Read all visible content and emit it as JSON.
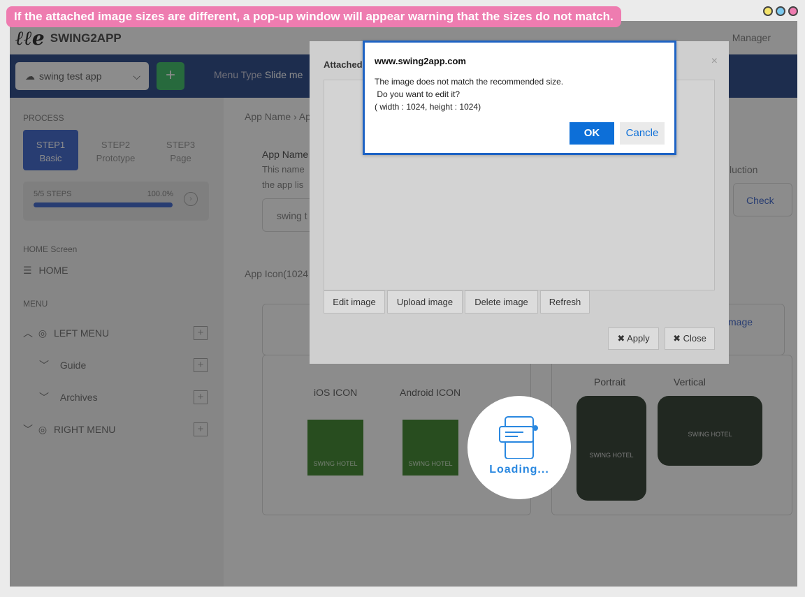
{
  "caption": "If the attached image sizes are different, a pop-up window will appear warning that the sizes do not match.",
  "window_dots": {
    "colors": [
      "#f5e46a",
      "#7ac8ee",
      "#ee7cb0"
    ]
  },
  "topbar": {
    "brand": "SWING2APP",
    "manager": "Manager"
  },
  "toolbar": {
    "app_select": "swing test app",
    "add_label": "+",
    "menu_type_label": "Menu Type",
    "menu_type_value": "Slide me"
  },
  "sidebar": {
    "process_label": "PROCESS",
    "steps": [
      {
        "num": "STEP1",
        "name": "Basic"
      },
      {
        "num": "STEP2",
        "name": "Prototype"
      },
      {
        "num": "STEP3",
        "name": "Page"
      }
    ],
    "progress_steps": "5/5 STEPS",
    "progress_pct": "100.0%",
    "progress_value": 1.0,
    "home_screen_label": "HOME Screen",
    "home_item": "HOME",
    "menu_label": "MENU",
    "items": [
      {
        "label": "LEFT MENU"
      },
      {
        "label": "Guide"
      },
      {
        "label": "Archives"
      },
      {
        "label": "RIGHT MENU"
      }
    ]
  },
  "main": {
    "breadcrumb": "App Name › Ap",
    "app_name_label": "App Name",
    "app_name_help1": "This name",
    "app_name_help2": "the app lis",
    "app_name_value": "swing t",
    "intro_fragment": "luction",
    "check_button": "Check",
    "app_icon_label": "App Icon(1024",
    "image_fragment": "mage",
    "ios_icon": "iOS ICON",
    "android_icon": "Android ICON",
    "hotel_text": "SWING HOTEL",
    "portrait": "Portrait",
    "vertical": "Vertical"
  },
  "attach_modal": {
    "title": "Attached",
    "close": "×",
    "buttons": {
      "edit": "Edit image",
      "upload": "Upload image",
      "delete": "Delete image",
      "refresh": "Refresh"
    },
    "apply": "Apply",
    "close_btn": "Close"
  },
  "alert": {
    "site": "www.swing2app.com",
    "line1": "The image does not match the recommended size.",
    "line2": " Do you want to edit it?",
    "line3": "( width : 1024, height : 1024)",
    "ok": "OK",
    "cancel": "Cancle"
  },
  "loader": {
    "text": "Loading..."
  }
}
